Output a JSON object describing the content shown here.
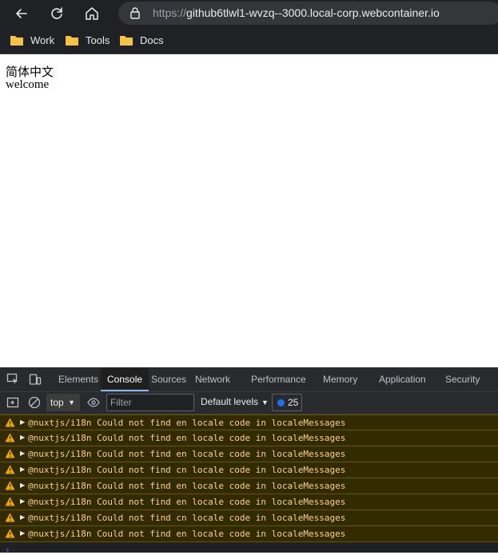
{
  "browser": {
    "url_scheme": "https://",
    "url_host": "github6tlwl1-wvzq--3000.local-corp.webcontainer.io"
  },
  "bookmarks": [
    {
      "label": "Work",
      "icon": "folder-icon"
    },
    {
      "label": "Tools",
      "icon": "folder-icon"
    },
    {
      "label": "Docs",
      "icon": "folder-icon"
    }
  ],
  "page": {
    "line1": "简体中文",
    "line2": "welcome"
  },
  "devtools": {
    "tabs": [
      "Elements",
      "Console",
      "Sources",
      "Network",
      "Performance",
      "Memory",
      "Application",
      "Security"
    ],
    "active_tab": "Console",
    "context": "top",
    "filter_placeholder": "Filter",
    "levels_label": "Default levels",
    "issues_count": "25",
    "console_messages": [
      "@nuxtjs/i18n Could not find en locale code in localeMessages",
      "@nuxtjs/i18n Could not find en locale code in localeMessages",
      "@nuxtjs/i18n Could not find en locale code in localeMessages",
      "@nuxtjs/i18n Could not find cn locale code in localeMessages",
      "@nuxtjs/i18n Could not find en locale code in localeMessages",
      "@nuxtjs/i18n Could not find en locale code in localeMessages",
      "@nuxtjs/i18n Could not find cn locale code in localeMessages",
      "@nuxtjs/i18n Could not find en locale code in localeMessages"
    ],
    "prompt_symbol": "›"
  },
  "colors": {
    "warning_bg": "#332b00",
    "warning_text": "#fbcf8e",
    "accent": "#8ab4f8"
  }
}
